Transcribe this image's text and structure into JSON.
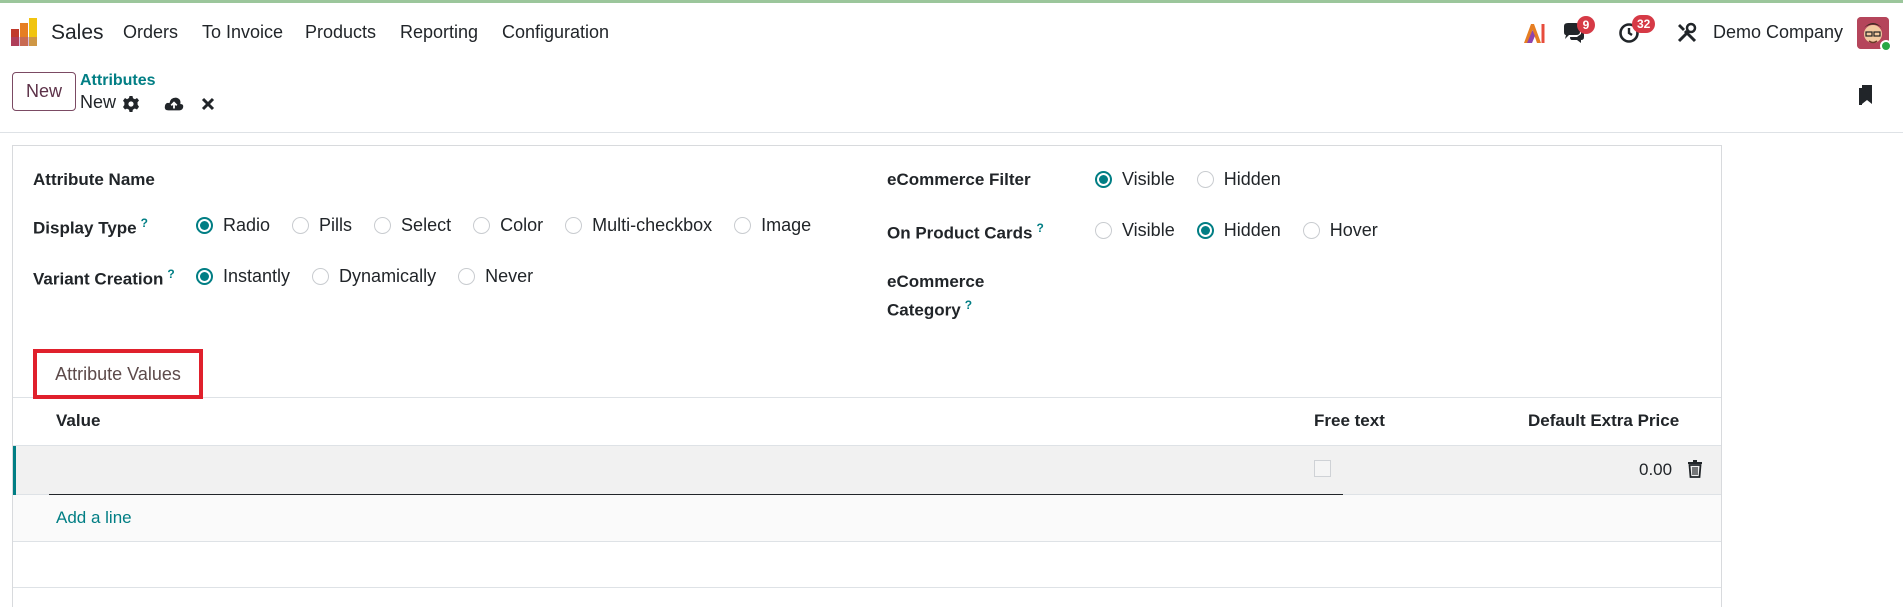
{
  "navbar": {
    "app_name": "Sales",
    "menu": [
      "Orders",
      "To Invoice",
      "Products",
      "Reporting",
      "Configuration"
    ],
    "messages_count": "9",
    "activities_count": "32",
    "company": "Demo Company"
  },
  "control_panel": {
    "new_label": "New",
    "breadcrumb_parent": "Attributes",
    "breadcrumb_current": "New"
  },
  "form": {
    "attribute_name_label": "Attribute Name",
    "display_type_label": "Display Type",
    "display_type_options": [
      "Radio",
      "Pills",
      "Select",
      "Color",
      "Multi-checkbox",
      "Image"
    ],
    "display_type_selected": "Radio",
    "variant_creation_label": "Variant Creation",
    "variant_creation_options": [
      "Instantly",
      "Dynamically",
      "Never"
    ],
    "variant_creation_selected": "Instantly",
    "ecommerce_filter_label": "eCommerce Filter",
    "ecommerce_filter_options": [
      "Visible",
      "Hidden"
    ],
    "ecommerce_filter_selected": "Visible",
    "product_cards_label": "On Product Cards",
    "product_cards_options": [
      "Visible",
      "Hidden",
      "Hover"
    ],
    "product_cards_selected": "Hidden",
    "ecommerce_category_label_1": "eCommerce",
    "ecommerce_category_label_2": "Category",
    "help_mark": "?"
  },
  "tabs": {
    "attribute_values": "Attribute Values"
  },
  "table": {
    "headers": {
      "value": "Value",
      "free_text": "Free text",
      "default_extra_price": "Default Extra Price"
    },
    "rows": [
      {
        "value": "",
        "free_text": false,
        "price": "0.00"
      }
    ],
    "add_line": "Add a line"
  },
  "colors": {
    "accent": "#017e84",
    "brand": "#714b67",
    "badge": "#d63a46",
    "highlight": "#e0202c"
  }
}
